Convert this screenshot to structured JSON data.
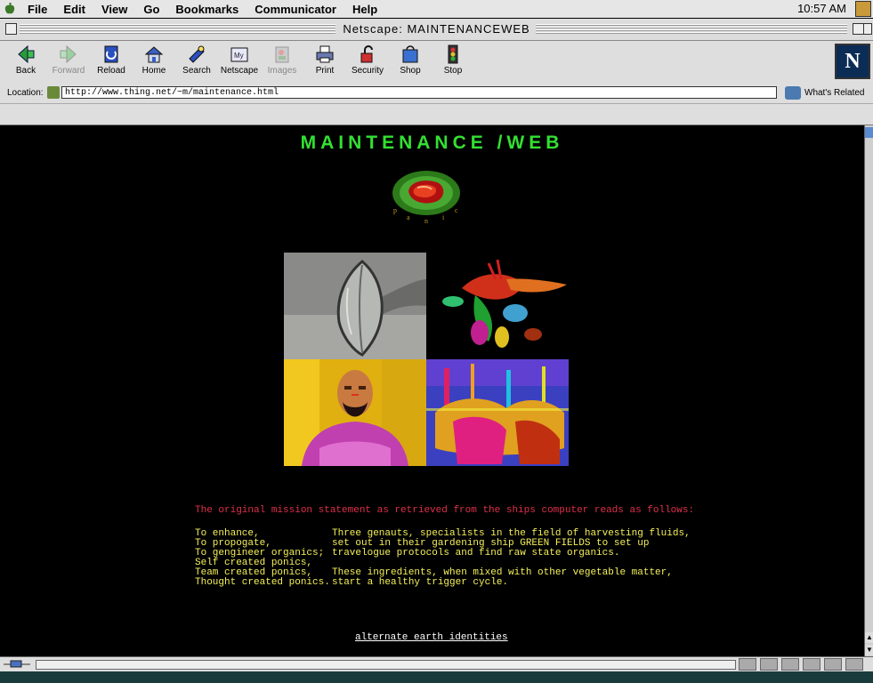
{
  "menubar": {
    "items": [
      "File",
      "Edit",
      "View",
      "Go",
      "Bookmarks",
      "Communicator",
      "Help"
    ],
    "clock": "10:57 AM"
  },
  "window": {
    "title": "Netscape: MAINTENANCEWEB"
  },
  "toolbar": {
    "buttons": [
      {
        "label": "Back",
        "icon": "back-arrow-icon",
        "enabled": true
      },
      {
        "label": "Forward",
        "icon": "forward-arrow-icon",
        "enabled": false
      },
      {
        "label": "Reload",
        "icon": "reload-icon",
        "enabled": true
      },
      {
        "label": "Home",
        "icon": "home-icon",
        "enabled": true
      },
      {
        "label": "Search",
        "icon": "search-icon",
        "enabled": true
      },
      {
        "label": "Netscape",
        "icon": "my-netscape-icon",
        "enabled": true
      },
      {
        "label": "Images",
        "icon": "images-icon",
        "enabled": false
      },
      {
        "label": "Print",
        "icon": "print-icon",
        "enabled": true
      },
      {
        "label": "Security",
        "icon": "security-lock-icon",
        "enabled": true
      },
      {
        "label": "Shop",
        "icon": "shop-icon",
        "enabled": true
      },
      {
        "label": "Stop",
        "icon": "stop-icon",
        "enabled": true
      }
    ],
    "logo": "N"
  },
  "location": {
    "label": "Location:",
    "url": "http://www.thing.net/~m/maintenance.html",
    "related_label": "What's Related"
  },
  "page": {
    "heading": "MAINTENANCE /WEB",
    "panic_letters": [
      "p",
      "a",
      "n",
      "i",
      "c"
    ],
    "mission_statement": "The original mission statement as retrieved from the ships computer reads as follows:",
    "left_lines": [
      "To enhance,",
      "To propogate,",
      "To gengineer organics;",
      "Self created ponics,",
      "Team created ponics,",
      "Thought created ponics."
    ],
    "right_lines": [
      "Three genauts, specialists in the field of harvesting fluids,",
      "set out in their gardening ship GREEN FIELDS to set up",
      "travelogue protocols and find raw state organics.",
      "",
      "These ingredients, when mixed with other vegetable matter,",
      "start a healthy trigger cycle."
    ],
    "link": "alternate earth identities"
  },
  "colors": {
    "heading": "#33e033",
    "mission": "#e0304a",
    "body_text": "#f5f05a",
    "background": "#000000"
  }
}
